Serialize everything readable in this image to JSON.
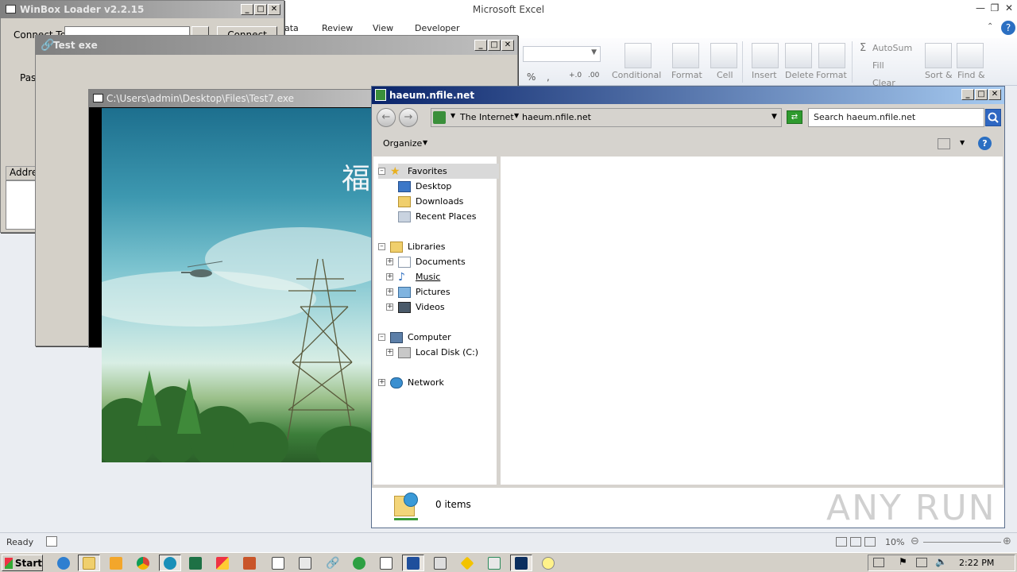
{
  "excel": {
    "title": "Microsoft Excel",
    "tabs": [
      "ata",
      "Review",
      "View",
      "Developer"
    ],
    "ribbon": {
      "number_symbols": [
        "%",
        ",",
        "+.0",
        ".00"
      ],
      "buttons": [
        "Conditional",
        "Format",
        "Cell",
        "Insert",
        "Delete",
        "Format"
      ],
      "editing": [
        "AutoSum",
        "Fill",
        "Clear",
        "Sort &",
        "Find &"
      ],
      "sigma": "Σ"
    },
    "status": "Ready",
    "zoom": "10%"
  },
  "winbox": {
    "title": "WinBox Loader v2.2.15",
    "connect_label": "Connect To:",
    "connect_button": "Connect",
    "login_label": "Pas",
    "address_header": "Addres"
  },
  "testexe": {
    "title": "Test exe"
  },
  "test7": {
    "title": "C:\\Users\\admin\\Desktop\\Files\\Test7.exe",
    "overlay_char": "福"
  },
  "explorer": {
    "title": "haeum.nfile.net",
    "address": {
      "segment1": "The Internet",
      "segment2": "haeum.nfile.net"
    },
    "search_placeholder": "Search haeum.nfile.net",
    "toolbar": {
      "organize": "Organize"
    },
    "nav": {
      "favorites": "Favorites",
      "desktop": "Desktop",
      "downloads": "Downloads",
      "recent": "Recent Places",
      "libraries": "Libraries",
      "documents": "Documents",
      "music": "Music",
      "pictures": "Pictures",
      "videos": "Videos",
      "computer": "Computer",
      "local_disk": "Local Disk (C:)",
      "network": "Network"
    },
    "details": {
      "count": "0 items"
    }
  },
  "taskbar": {
    "start": "Start",
    "clock": "2:22 PM"
  },
  "watermark": "ANY RUN"
}
